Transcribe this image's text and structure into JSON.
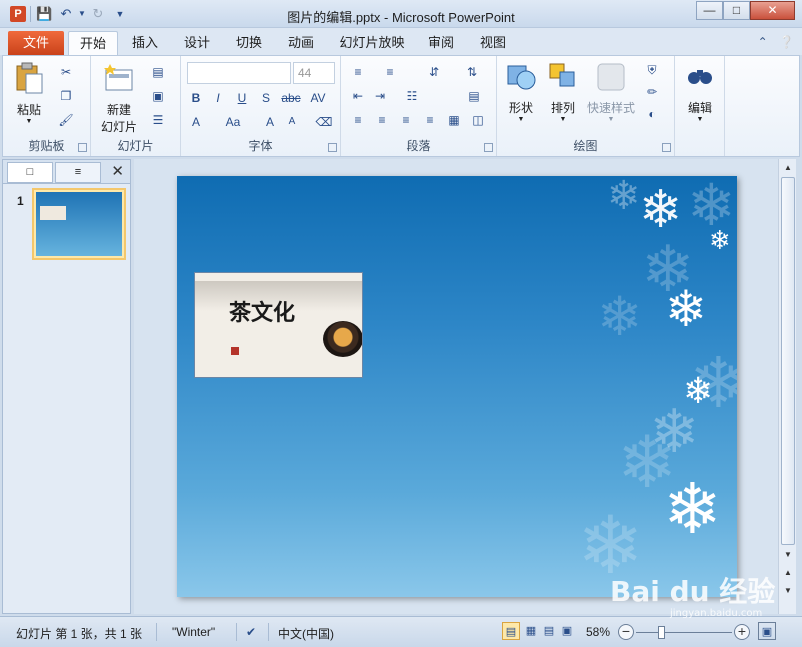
{
  "window": {
    "title": "图片的编辑.pptx - Microsoft PowerPoint",
    "app_icon": "P"
  },
  "quick_access": [
    "save-icon",
    "undo-icon",
    "redo-icon",
    "customize-icon"
  ],
  "ribbon": {
    "file_tab": "文件",
    "tabs": [
      "开始",
      "插入",
      "设计",
      "切换",
      "动画",
      "幻灯片放映",
      "审阅",
      "视图"
    ],
    "active_tab": "开始",
    "groups": {
      "clipboard": {
        "label": "剪贴板",
        "paste": "粘贴"
      },
      "slides": {
        "label": "幻灯片",
        "new_slide_line1": "新建",
        "new_slide_line2": "幻灯片"
      },
      "font": {
        "label": "字体",
        "font_name": "",
        "font_size": "44",
        "buttons": [
          "B",
          "I",
          "U",
          "S",
          "abc",
          "AV",
          "A",
          "Aa",
          "A",
          "A"
        ]
      },
      "paragraph": {
        "label": "段落"
      },
      "drawing": {
        "label": "绘图",
        "shapes": "形状",
        "arrange": "排列",
        "quick_styles": "快速样式"
      },
      "editing": {
        "label": "编辑"
      }
    }
  },
  "left_pane": {
    "slide_number": "1"
  },
  "slide": {
    "picture_text": "茶文化",
    "background": "Winter"
  },
  "status": {
    "slide_info": "幻灯片 第 1 张，共 1 张",
    "theme": "\"Winter\"",
    "language": "中文(中国)",
    "zoom": "58%"
  },
  "watermark": {
    "brand": "Bai du 经验",
    "url": "jingyan.baidu.com"
  },
  "colors": {
    "file_tab": "#d24726",
    "slide_top": "#0f6cb2",
    "slide_bottom": "#8ac7ea"
  }
}
